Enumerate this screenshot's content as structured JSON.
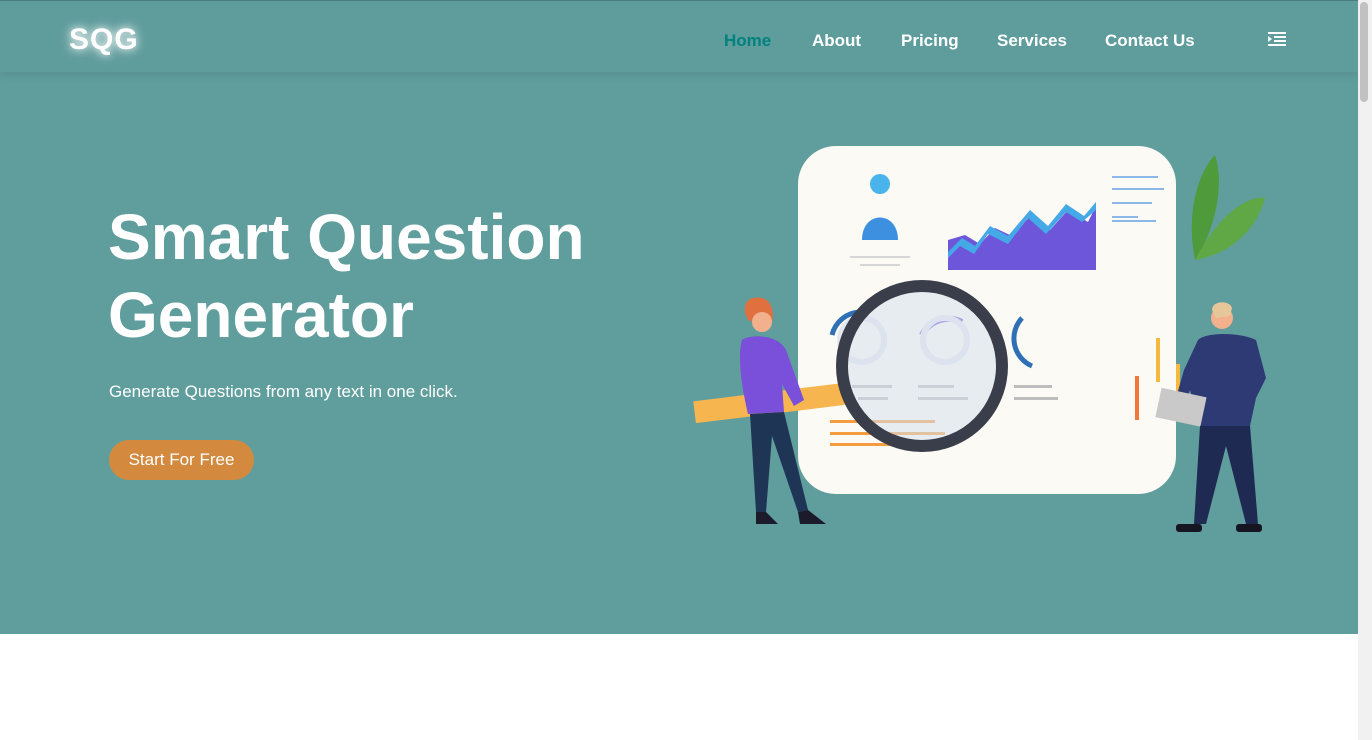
{
  "brand": {
    "logo_text": "SQG"
  },
  "nav": {
    "items": [
      {
        "label": "Home",
        "active": true
      },
      {
        "label": "About",
        "active": false
      },
      {
        "label": "Pricing",
        "active": false
      },
      {
        "label": "Services",
        "active": false
      },
      {
        "label": "Contact Us",
        "active": false
      }
    ],
    "menu_icon": "menu-collapse-icon"
  },
  "hero": {
    "title_line1": "Smart Question",
    "title_line2": "Generator",
    "subtitle": "Generate Questions from any text in one click.",
    "cta_label": "Start For Free",
    "illustration_icon": "data-analysis-illustration"
  },
  "colors": {
    "hero_bg": "#609e9e",
    "nav_active": "#00827f",
    "cta_bg": "#d48a3e",
    "text_light": "#ffffff"
  }
}
